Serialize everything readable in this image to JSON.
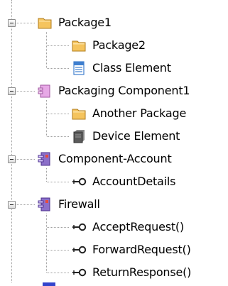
{
  "tree": {
    "nodes": [
      {
        "id": "package1",
        "label": "Package1",
        "icon": "folder-icon",
        "expanded": true
      },
      {
        "id": "package2",
        "label": "Package2",
        "icon": "folder-icon"
      },
      {
        "id": "class-element",
        "label": "Class Element",
        "icon": "class-icon"
      },
      {
        "id": "packaging-component1",
        "label": "Packaging Component1",
        "icon": "packaging-component-icon",
        "expanded": true
      },
      {
        "id": "another-package",
        "label": "Another Package",
        "icon": "folder-icon"
      },
      {
        "id": "device-element",
        "label": "Device Element",
        "icon": "device-icon"
      },
      {
        "id": "component-account",
        "label": "Component-Account",
        "icon": "component-icon",
        "expanded": true
      },
      {
        "id": "account-details",
        "label": "AccountDetails",
        "icon": "interface-icon"
      },
      {
        "id": "firewall",
        "label": "Firewall",
        "icon": "component-icon",
        "expanded": true
      },
      {
        "id": "accept-request",
        "label": "AcceptRequest()",
        "icon": "interface-icon"
      },
      {
        "id": "forward-request",
        "label": "ForwardRequest()",
        "icon": "interface-icon"
      },
      {
        "id": "return-response",
        "label": "ReturnResponse()",
        "icon": "interface-icon"
      }
    ]
  },
  "colors": {
    "folder": "#f5c45e",
    "packaging_component": "#e7a8e6",
    "component": "#8c6fc9",
    "class": "#3f7fcf",
    "device": "#5a5a5a",
    "tree_line": "#a0a0a0"
  }
}
